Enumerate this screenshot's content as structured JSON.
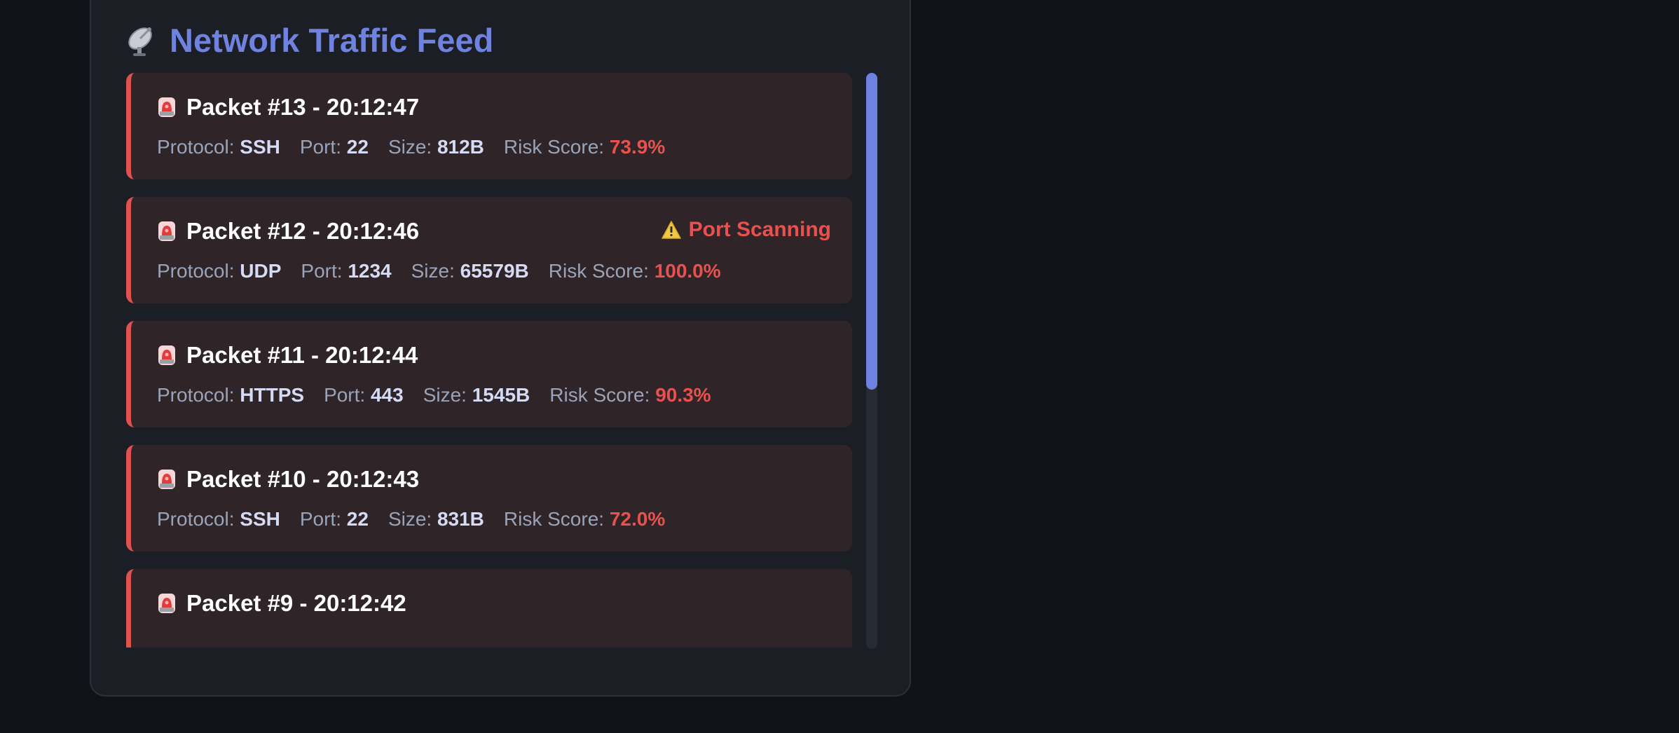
{
  "panel": {
    "title": "Network Traffic Feed",
    "title_icon": "satellite-antenna-icon"
  },
  "labels": {
    "protocol": "Protocol:",
    "port": "Port:",
    "size": "Size:",
    "risk": "Risk Score:"
  },
  "packets": [
    {
      "title": "Packet #13 - 20:12:47",
      "protocol": "SSH",
      "port": "22",
      "size": "812B",
      "risk": "73.9%",
      "alert": ""
    },
    {
      "title": "Packet #12 - 20:12:46",
      "protocol": "UDP",
      "port": "1234",
      "size": "65579B",
      "risk": "100.0%",
      "alert": "Port Scanning"
    },
    {
      "title": "Packet #11 - 20:12:44",
      "protocol": "HTTPS",
      "port": "443",
      "size": "1545B",
      "risk": "90.3%",
      "alert": ""
    },
    {
      "title": "Packet #10 - 20:12:43",
      "protocol": "SSH",
      "port": "22",
      "size": "831B",
      "risk": "72.0%",
      "alert": ""
    },
    {
      "title": "Packet #9 - 20:12:42",
      "protocol": "",
      "port": "",
      "size": "",
      "risk": "",
      "alert": ""
    }
  ],
  "icons": {
    "packet": "siren-icon",
    "alert": "warning-icon"
  },
  "colors": {
    "accent": "#6f82e0",
    "danger": "#e8514e",
    "card_bg": "#2f2528",
    "panel_bg": "#1b1e24",
    "page_bg": "#0f1216"
  }
}
